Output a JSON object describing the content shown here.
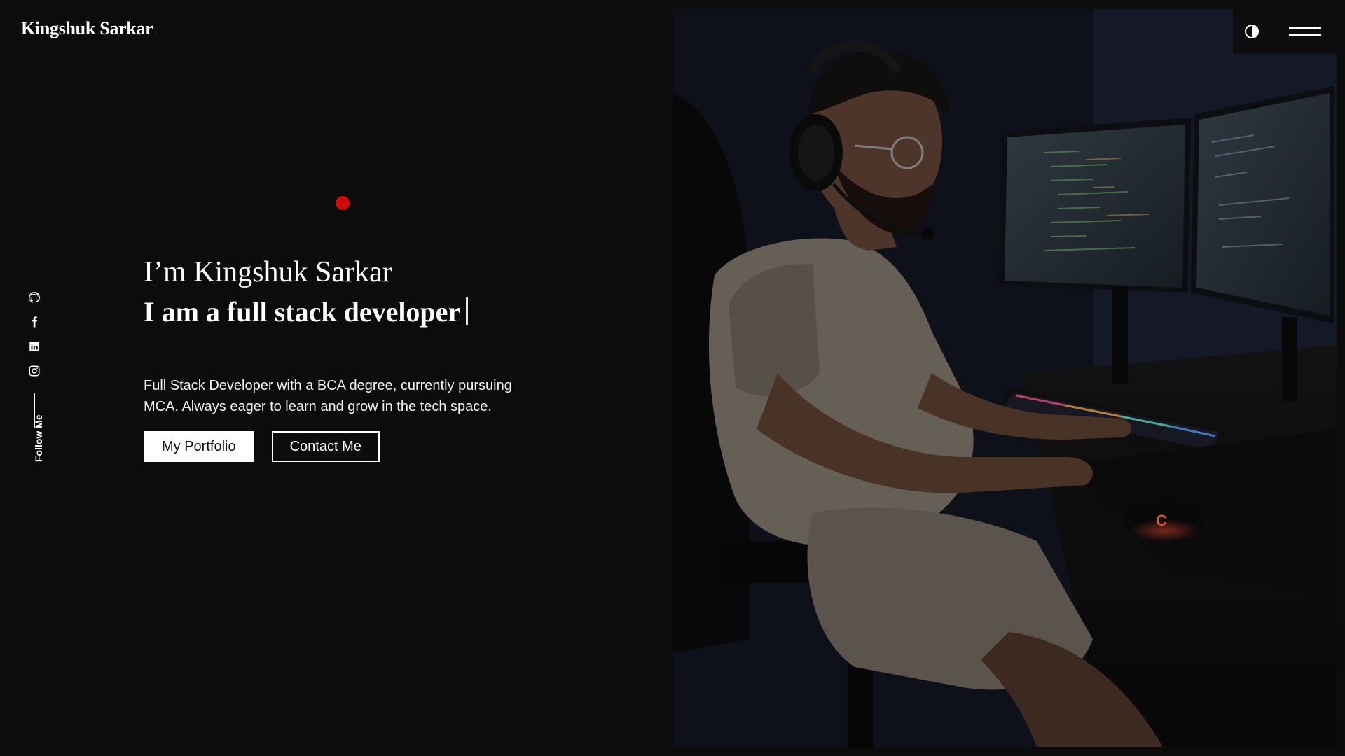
{
  "header": {
    "brand": "Kingshuk Sarkar",
    "theme_toggle_icon": "contrast-icon",
    "menu_icon": "hamburger-icon"
  },
  "sidebar": {
    "socials": [
      {
        "name": "github",
        "icon": "github-icon"
      },
      {
        "name": "facebook",
        "icon": "facebook-icon"
      },
      {
        "name": "linkedin",
        "icon": "linkedin-icon"
      },
      {
        "name": "instagram",
        "icon": "instagram-icon"
      }
    ],
    "follow_label": "Follow Me"
  },
  "hero": {
    "greeting": "I’m Kingshuk Sarkar",
    "role": "I am a full stack developer",
    "description": "Full Stack Developer with a BCA degree, currently pursuing MCA. Always eager to learn and grow in the tech space.",
    "buttons": {
      "portfolio": "My Portfolio",
      "contact": "Contact Me"
    }
  },
  "colors": {
    "background": "#0c0c0c",
    "accent_dot": "#d10a0a",
    "text": "#ffffff"
  }
}
